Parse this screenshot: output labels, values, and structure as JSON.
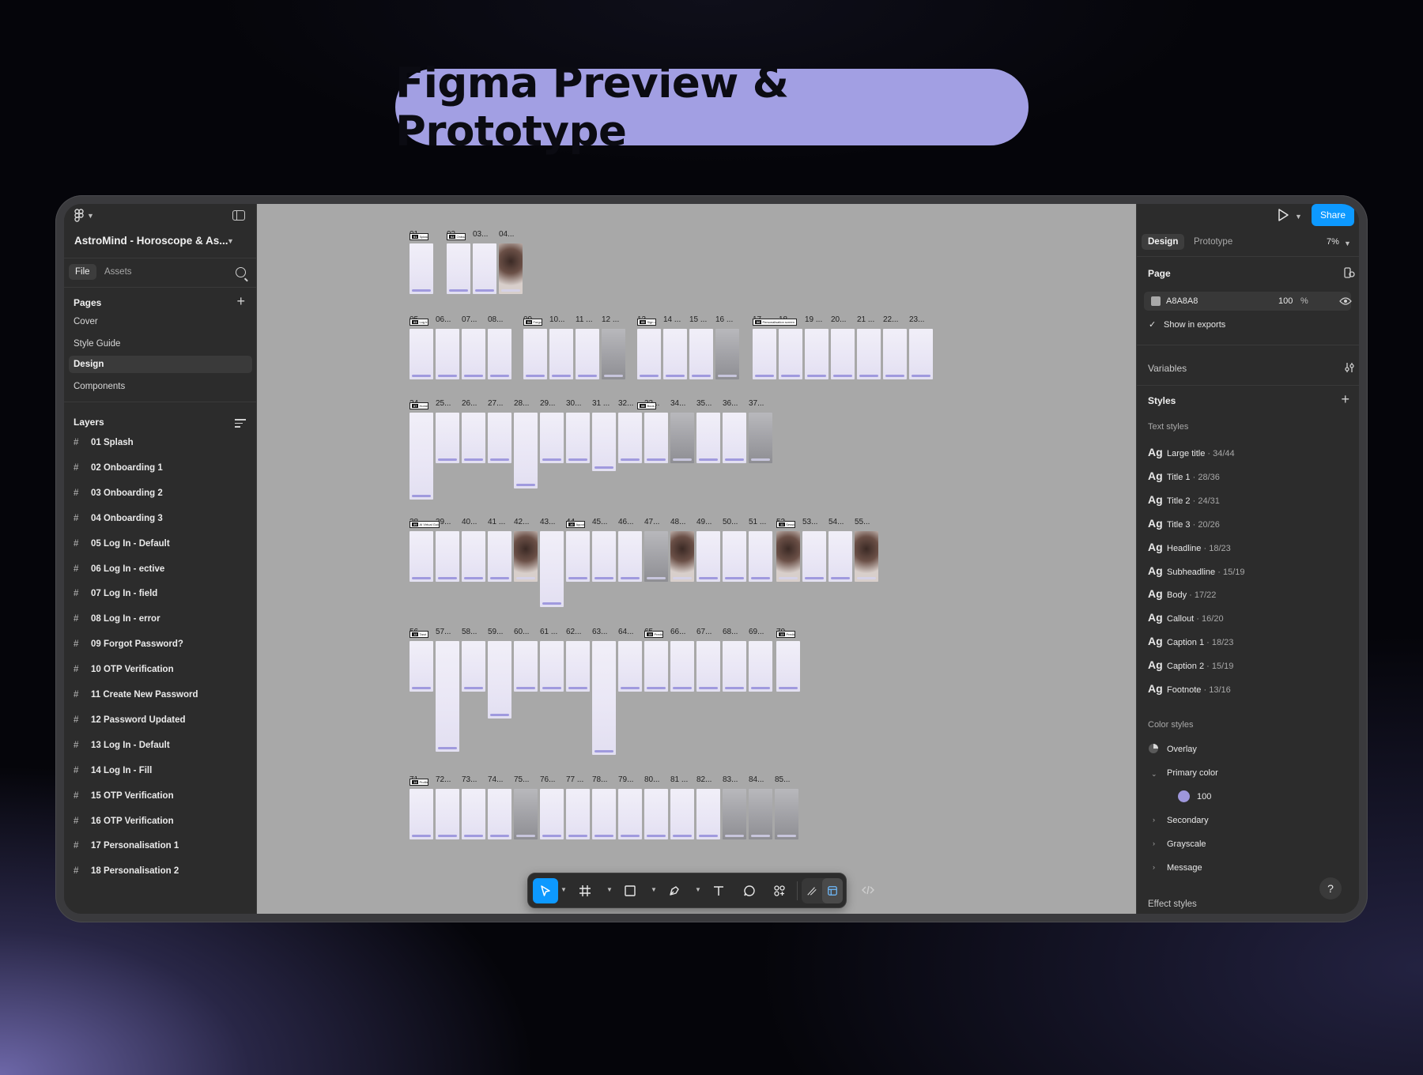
{
  "hero": {
    "title": "Figma Preview & Prototype"
  },
  "left_panel": {
    "file_title": "AstroMind - Horoscope & As...",
    "tabs": {
      "file": "File",
      "assets": "Assets"
    },
    "pages_heading": "Pages",
    "pages": [
      "Cover",
      "Style Guide",
      "Design",
      "Components"
    ],
    "active_page": "Design",
    "layers_heading": "Layers",
    "layers": [
      "01 Splash",
      "02 Onboarding 1",
      "03 Onboarding 2",
      "04 Onboarding 3",
      "05 Log In - Default",
      "06 Log In - ective",
      "07 Log In - field",
      "08 Log In - error",
      "09 Forgot Password?",
      "10 OTP Verification",
      "11 Create New Password",
      "12 Password Updated",
      "13 Log In - Default",
      "14 Log In - Fill",
      "15 OTP Verification",
      "16 OTP Verification",
      "17 Personalisation 1",
      "18 Personalisation 2"
    ]
  },
  "canvas": {
    "background": "#A8A8A8",
    "frame_labels": {
      "row1": [
        "01...",
        "02...",
        "03...",
        "04..."
      ],
      "row2": [
        "05...",
        "06...",
        "07...",
        "08...",
        "09...",
        "10...",
        "11 ...",
        "12 ...",
        "13 ...",
        "14 ...",
        "15 ...",
        "16 ...",
        "17 ...",
        "18 ...",
        "19 ...",
        "20...",
        "21 ...",
        "22...",
        "23..."
      ],
      "row3": [
        "24...",
        "25...",
        "26...",
        "27...",
        "28...",
        "29...",
        "30...",
        "31 ...",
        "32...",
        "33...",
        "34...",
        "35...",
        "36...",
        "37..."
      ],
      "row4": [
        "38...",
        "39...",
        "40...",
        "41 ...",
        "42...",
        "43...",
        "44...",
        "45...",
        "46...",
        "47...",
        "48...",
        "49...",
        "50...",
        "51 ...",
        "52...",
        "53...",
        "54...",
        "55..."
      ],
      "row5": [
        "56...",
        "57...",
        "58...",
        "59...",
        "60...",
        "61 ...",
        "62...",
        "63...",
        "64...",
        "65...",
        "66...",
        "67...",
        "68...",
        "69...",
        "70..."
      ],
      "row6": [
        "71 ...",
        "72...",
        "73...",
        "74...",
        "75...",
        "76...",
        "77 ...",
        "78...",
        "79...",
        "80...",
        "81 ...",
        "82...",
        "83...",
        "84...",
        "85..."
      ]
    },
    "group_tags": [
      "Splash",
      "Onboarding",
      "Log In",
      "Forgot Password",
      "Sign up",
      "Personalisation screen",
      "Home screen",
      "Book Appointment",
      "AI Virtual Guide",
      "Appointment",
      "Session",
      "Tarot",
      "Predictions",
      "Profile"
    ],
    "group_numbers": [
      "01",
      "02",
      "03",
      "04",
      "05",
      "06",
      "07",
      "08",
      "09",
      "10",
      "11",
      "12",
      "13",
      "14"
    ]
  },
  "toolbar": {
    "tools": [
      "move-tool",
      "frame-tool",
      "shape-tool",
      "pen-tool",
      "text-tool",
      "comment-tool",
      "actions-tool",
      "draw-mode",
      "design-mode",
      "dev-mode"
    ],
    "active_tool": "move-tool",
    "accent": "#0D99FF"
  },
  "right_panel": {
    "share_label": "Share",
    "tabs": {
      "design": "Design",
      "prototype": "Prototype"
    },
    "zoom": "7%",
    "page_heading": "Page",
    "page_color": {
      "hex": "A8A8A8",
      "opacity": "100",
      "unit": "%"
    },
    "show_in_exports": "Show in exports",
    "variables_heading": "Variables",
    "styles_heading": "Styles",
    "text_styles_heading": "Text styles",
    "text_styles": [
      {
        "ag": "Ag",
        "name": "Large title",
        "meta": "34/44"
      },
      {
        "ag": "Ag",
        "name": "Title 1",
        "meta": "28/36"
      },
      {
        "ag": "Ag",
        "name": "Title 2",
        "meta": "24/31"
      },
      {
        "ag": "Ag",
        "name": "Title 3",
        "meta": "20/26"
      },
      {
        "ag": "Ag",
        "name": "Headline",
        "meta": "18/23"
      },
      {
        "ag": "Ag",
        "name": "Subheadline",
        "meta": "15/19"
      },
      {
        "ag": "Ag",
        "name": "Body",
        "meta": "17/22"
      },
      {
        "ag": "Ag",
        "name": "Callout",
        "meta": "16/20"
      },
      {
        "ag": "Ag",
        "name": "Caption 1",
        "meta": "18/23"
      },
      {
        "ag": "Ag",
        "name": "Caption 2",
        "meta": "15/19"
      },
      {
        "ag": "Ag",
        "name": "Footnote",
        "meta": "13/16"
      }
    ],
    "color_styles_heading": "Color styles",
    "color_styles": {
      "overlay": "Overlay",
      "primary": "Primary color",
      "primary_100": "100",
      "primary_100_color": "#9E97DB",
      "secondary": "Secondary",
      "grayscale": "Grayscale",
      "message": "Message"
    },
    "effect_styles_heading": "Effect styles",
    "help": "?"
  },
  "colors": {
    "hero_pill": "#A29FE3",
    "accent": "#0D99FF",
    "panel_bg": "#2C2C2C"
  }
}
